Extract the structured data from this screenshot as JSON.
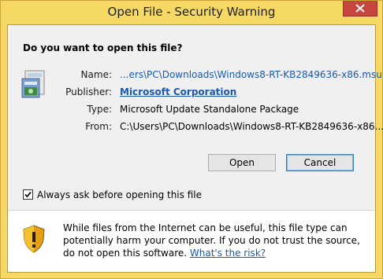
{
  "window": {
    "title": "Open File - Security Warning"
  },
  "dialog": {
    "question": "Do you want to open this file?",
    "fields": {
      "name_label": "Name:",
      "name_value": "...ers\\PC\\Downloads\\Windows8-RT-KB2849636-x86.msu",
      "publisher_label": "Publisher:",
      "publisher_value": "Microsoft Corporation",
      "type_label": "Type:",
      "type_value": "Microsoft Update Standalone Package",
      "from_label": "From:",
      "from_value": "C:\\Users\\PC\\Downloads\\Windows8-RT-KB2849636-x86..."
    },
    "buttons": {
      "open": "Open",
      "cancel": "Cancel"
    },
    "checkbox": {
      "label": "Always ask before opening this file",
      "checked": true
    },
    "warning": {
      "text": "While files from the Internet can be useful, this file type can potentially harm your computer. If you do not trust the source, do not open this software.",
      "link": "What's the risk?"
    }
  },
  "colors": {
    "frame": "#f6d865",
    "close_button": "#c7463e",
    "link": "#1a59b0"
  },
  "icons": {
    "close": "close-icon",
    "package": "update-package-icon",
    "shield": "security-shield-icon"
  }
}
